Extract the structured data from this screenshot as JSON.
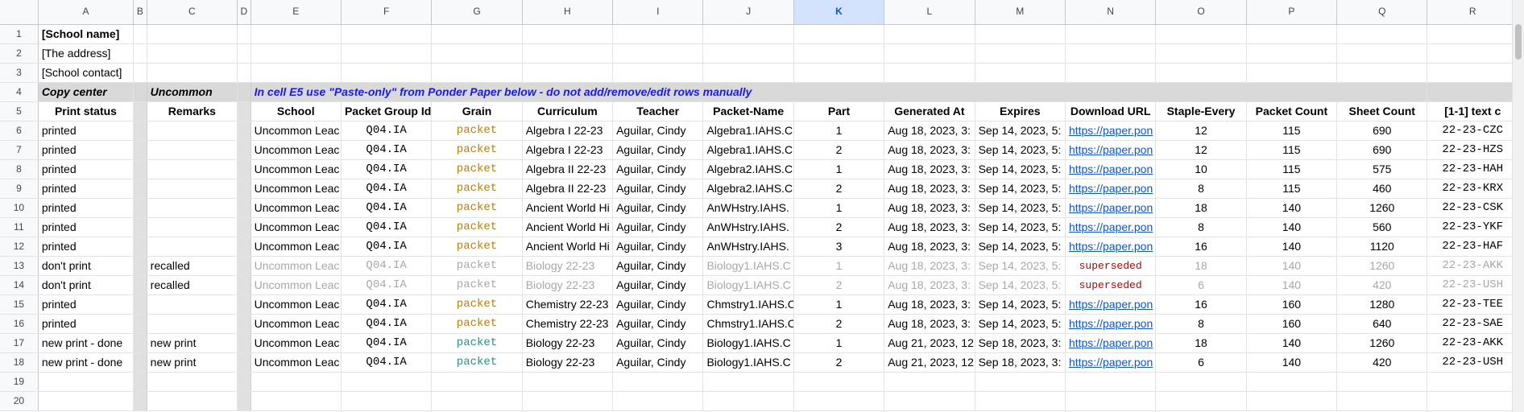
{
  "columns": [
    "",
    "A",
    "B",
    "C",
    "D",
    "E",
    "F",
    "G",
    "H",
    "I",
    "J",
    "K",
    "L",
    "M",
    "N",
    "O",
    "P",
    "Q",
    "R"
  ],
  "selected_column": "K",
  "rows": [
    {
      "num": "1",
      "a": "[School name]"
    },
    {
      "num": "2",
      "a": "[The address]"
    },
    {
      "num": "3",
      "a": "[School contact]"
    },
    {
      "num": "4",
      "a": "Copy center",
      "c": "Uncommon",
      "banner": "In cell E5 use \"Paste-only\" from Ponder Paper below - do not add/remove/edit rows manually"
    },
    {
      "num": "5",
      "h": [
        "Print status",
        "",
        "Remarks",
        "",
        "School",
        "Packet Group Id",
        "Grain",
        "Curriculum",
        "Teacher",
        "Packet-Name",
        "Part",
        "Generated At",
        "Expires",
        "Download URL",
        "Staple-Every",
        "Packet Count",
        "Sheet Count",
        "[1-1] text c"
      ]
    },
    {
      "num": "6",
      "d": [
        "printed",
        "",
        "",
        "",
        "Uncommon Leac",
        "Q04.IA",
        "packet",
        "Algebra I 22-23",
        "Aguilar, Cindy",
        "Algebra1.IAHS.C",
        "1",
        "Aug 18, 2023, 3:",
        "Sep 14, 2023, 5:",
        "https://paper.pon",
        "12",
        "115",
        "690",
        "22-23-CZC"
      ]
    },
    {
      "num": "7",
      "d": [
        "printed",
        "",
        "",
        "",
        "Uncommon Leac",
        "Q04.IA",
        "packet",
        "Algebra I 22-23",
        "Aguilar, Cindy",
        "Algebra1.IAHS.C",
        "2",
        "Aug 18, 2023, 3:",
        "Sep 14, 2023, 5:",
        "https://paper.pon",
        "12",
        "115",
        "690",
        "22-23-HZS"
      ]
    },
    {
      "num": "8",
      "d": [
        "printed",
        "",
        "",
        "",
        "Uncommon Leac",
        "Q04.IA",
        "packet",
        "Algebra II 22-23",
        "Aguilar, Cindy",
        "Algebra2.IAHS.C",
        "1",
        "Aug 18, 2023, 3:",
        "Sep 14, 2023, 5:",
        "https://paper.pon",
        "10",
        "115",
        "575",
        "22-23-HAH"
      ]
    },
    {
      "num": "9",
      "d": [
        "printed",
        "",
        "",
        "",
        "Uncommon Leac",
        "Q04.IA",
        "packet",
        "Algebra II 22-23",
        "Aguilar, Cindy",
        "Algebra2.IAHS.C",
        "2",
        "Aug 18, 2023, 3:",
        "Sep 14, 2023, 5:",
        "https://paper.pon",
        "8",
        "115",
        "460",
        "22-23-KRX"
      ]
    },
    {
      "num": "10",
      "d": [
        "printed",
        "",
        "",
        "",
        "Uncommon Leac",
        "Q04.IA",
        "packet",
        "Ancient World Hi",
        "Aguilar, Cindy",
        "AnWHstry.IAHS.",
        "1",
        "Aug 18, 2023, 3:",
        "Sep 14, 2023, 5:",
        "https://paper.pon",
        "18",
        "140",
        "1260",
        "22-23-CSK"
      ]
    },
    {
      "num": "11",
      "d": [
        "printed",
        "",
        "",
        "",
        "Uncommon Leac",
        "Q04.IA",
        "packet",
        "Ancient World Hi",
        "Aguilar, Cindy",
        "AnWHstry.IAHS.",
        "2",
        "Aug 18, 2023, 3:",
        "Sep 14, 2023, 5:",
        "https://paper.pon",
        "8",
        "140",
        "560",
        "22-23-YKF"
      ]
    },
    {
      "num": "12",
      "d": [
        "printed",
        "",
        "",
        "",
        "Uncommon Leac",
        "Q04.IA",
        "packet",
        "Ancient World Hi",
        "Aguilar, Cindy",
        "AnWHstry.IAHS.",
        "3",
        "Aug 18, 2023, 3:",
        "Sep 14, 2023, 5:",
        "https://paper.pon",
        "16",
        "140",
        "1120",
        "22-23-HAF"
      ]
    },
    {
      "num": "13",
      "gray": true,
      "d": [
        "don't print",
        "",
        "recalled",
        "",
        "Uncommon Leac",
        "Q04.IA",
        "packet",
        "Biology 22-23",
        "Aguilar, Cindy",
        "Biology1.IAHS.C",
        "1",
        "Aug 18, 2023, 3:",
        "Sep 14, 2023, 5:",
        "superseded",
        "18",
        "140",
        "1260",
        "22-23-AKK"
      ]
    },
    {
      "num": "14",
      "gray": true,
      "d": [
        "don't print",
        "",
        "recalled",
        "",
        "Uncommon Leac",
        "Q04.IA",
        "packet",
        "Biology 22-23",
        "Aguilar, Cindy",
        "Biology1.IAHS.C",
        "2",
        "Aug 18, 2023, 3:",
        "Sep 14, 2023, 5:",
        "superseded",
        "6",
        "140",
        "420",
        "22-23-USH"
      ]
    },
    {
      "num": "15",
      "d": [
        "printed",
        "",
        "",
        "",
        "Uncommon Leac",
        "Q04.IA",
        "packet",
        "Chemistry 22-23",
        "Aguilar, Cindy",
        "Chmstry1.IAHS.C",
        "1",
        "Aug 18, 2023, 3:",
        "Sep 14, 2023, 5:",
        "https://paper.pon",
        "16",
        "160",
        "1280",
        "22-23-TEE"
      ]
    },
    {
      "num": "16",
      "d": [
        "printed",
        "",
        "",
        "",
        "Uncommon Leac",
        "Q04.IA",
        "packet",
        "Chemistry 22-23",
        "Aguilar, Cindy",
        "Chmstry1.IAHS.C",
        "2",
        "Aug 18, 2023, 3:",
        "Sep 14, 2023, 5:",
        "https://paper.pon",
        "8",
        "160",
        "640",
        "22-23-SAE"
      ]
    },
    {
      "num": "17",
      "newgrain": true,
      "d": [
        "new print - done",
        "",
        "new print",
        "",
        "Uncommon Leac",
        "Q04.IA",
        "packet",
        "Biology 22-23",
        "Aguilar, Cindy",
        "Biology1.IAHS.C",
        "1",
        "Aug 21, 2023, 12",
        "Sep 18, 2023, 3:",
        "https://paper.pon",
        "18",
        "140",
        "1260",
        "22-23-AKK"
      ]
    },
    {
      "num": "18",
      "newgrain": true,
      "d": [
        "new print - done",
        "",
        "new print",
        "",
        "Uncommon Leac",
        "Q04.IA",
        "packet",
        "Biology 22-23",
        "Aguilar, Cindy",
        "Biology1.IAHS.C",
        "2",
        "Aug 21, 2023, 12",
        "Sep 18, 2023, 3:",
        "https://paper.pon",
        "6",
        "140",
        "420",
        "22-23-USH"
      ]
    },
    {
      "num": "19"
    },
    {
      "num": "20"
    }
  ]
}
